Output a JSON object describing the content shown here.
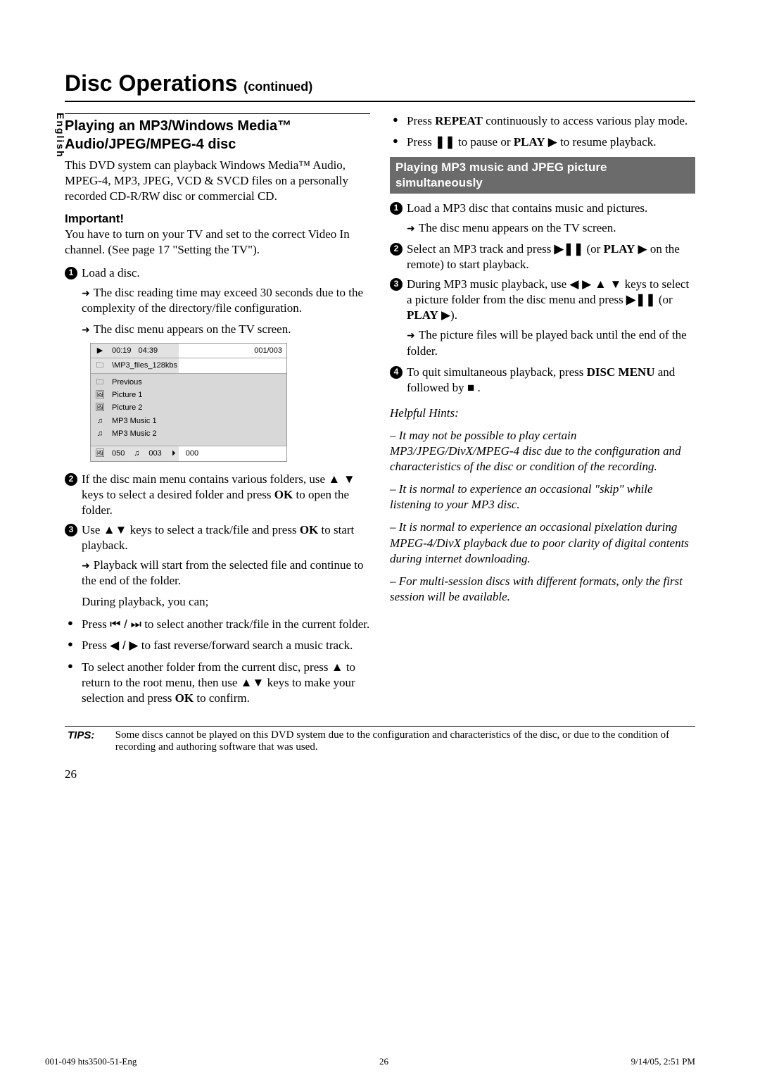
{
  "lang": "English",
  "header": {
    "title": "Disc Operations",
    "cont": "(continued)"
  },
  "left": {
    "subhead": "Playing an MP3/Windows Media™ Audio/JPEG/MPEG-4 disc",
    "intro": "This DVD system can playback Windows Media™ Audio, MPEG-4, MP3, JPEG, VCD & SVCD files on a personally recorded CD-R/RW disc or commercial CD.",
    "important_label": "Important!",
    "important_text": "You have to turn on your TV and set to the correct Video In channel.  (See page 17 \"Setting the TV\").",
    "step1": "Load a disc.",
    "step1_note1": "The disc reading time may exceed 30 seconds due to the complexity of the directory/file configuration.",
    "step1_note2": "The disc menu appears on the TV screen.",
    "step2a": "If the disc main menu contains various folders, use ",
    "step2b": " keys to select a desired folder and press ",
    "step2c": " to open the folder.",
    "step3a": "Use ",
    "step3b": " keys to select a track/file and press ",
    "step3c": " to start playback.",
    "step3_note": "Playback will start from the selected file and continue to the end of the folder.",
    "during": "During playback, you can;",
    "b1a": "Press ",
    "b1b": " to select another track/file in the current folder.",
    "b2a": "Press ",
    "b2b": " to fast reverse/forward search a music track.",
    "b3a": "To select another folder from the current disc, press ",
    "b3b": " to return to the root menu, then use ",
    "b3c": " keys to make your selection and press ",
    "b3d": " to confirm.",
    "ok": "OK"
  },
  "screen": {
    "r1_time1": "00:19",
    "r1_time2": "04:39",
    "r1_track": "001/003",
    "r2": "\\MP3_files_128kbs",
    "items": [
      "Previous",
      "Picture 1",
      "Picture 2",
      "MP3 Music 1",
      "MP3 Music 2"
    ],
    "foot1": "050",
    "foot2": "003",
    "foot3": "000"
  },
  "right": {
    "b4a": "Press ",
    "repeat": "REPEAT",
    "b4b": " continuously to access various play mode.",
    "b5a": "Press ",
    "b5b": " to pause or ",
    "play": "PLAY",
    "b5c": " to resume playback.",
    "band": "Playing MP3 music and JPEG picture simultaneously",
    "s1a": "Load a MP3 disc that contains music and pictures.",
    "s1n": "The disc menu appears on the TV screen.",
    "s2a": "Select an MP3 track and press ",
    "s2b": " (or ",
    "s2c": " on the remote) to start playback.",
    "s3a": "During MP3 music playback, use ",
    "s3b": " keys to select a picture folder from the disc menu and press ",
    "s3c": " (or ",
    "s3d": ").",
    "s3n": "The picture files will be played back until the end of the folder.",
    "s4a": "To quit simultaneous playback, press ",
    "discmenu": "DISC MENU",
    "s4b": " and followed by ",
    "hh": "Helpful Hints:",
    "h1": "– It may not be possible to play certain MP3/JPEG/DivX/MPEG-4 disc due to the configuration and characteristics of the disc or condition of the recording.",
    "h2": "– It is normal to experience an occasional \"skip\" while listening to your MP3 disc.",
    "h3": "– It is normal to experience an occasional pixelation during MPEG-4/DivX playback due to poor clarity of digital contents during internet downloading.",
    "h4": "– For multi-session discs with different formats, only the first session will be available."
  },
  "tips": {
    "label": "TIPS:",
    "text": "Some discs cannot be played on this DVD system due to the configuration and characteristics of the disc, or due to the condition of recording and authoring software that was used."
  },
  "pageno": "26",
  "footer": {
    "left": "001-049 hts3500-51-Eng",
    "mid": "26",
    "right": "9/14/05, 2:51 PM"
  }
}
